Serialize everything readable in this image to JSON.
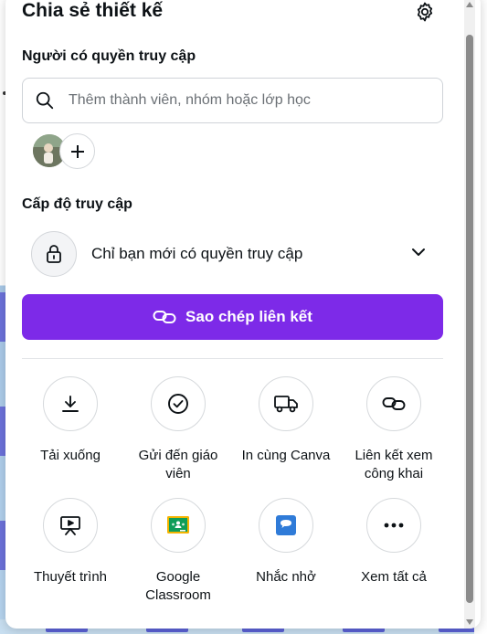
{
  "panel": {
    "title": "Chia sẻ thiết kế",
    "people_label": "Người có quyền truy cập",
    "search": {
      "placeholder": "Thêm thành viên, nhóm hoặc lớp học"
    },
    "access_label": "Cấp độ truy cập",
    "access_level": "Chỉ bạn mới có quyền truy cập",
    "copy_link_label": "Sao chép liên kết",
    "actions": [
      {
        "label": "Tải xuống",
        "icon": "download-icon"
      },
      {
        "label": "Gửi đến giáo viên",
        "icon": "check-circle-icon"
      },
      {
        "label": "In cùng Canva",
        "icon": "truck-icon"
      },
      {
        "label": "Liên kết xem công khai",
        "icon": "link-icon"
      },
      {
        "label": "Thuyết trình",
        "icon": "present-icon"
      },
      {
        "label": "Google Classroom",
        "icon": "google-classroom-icon"
      },
      {
        "label": "Nhắc nhở",
        "icon": "reminder-icon"
      },
      {
        "label": "Xem tất cả",
        "icon": "more-icon"
      }
    ]
  },
  "colors": {
    "accent": "#7d2ae8",
    "text": "#0d1216",
    "placeholder": "#6b7075",
    "border": "#cfd3d8"
  }
}
